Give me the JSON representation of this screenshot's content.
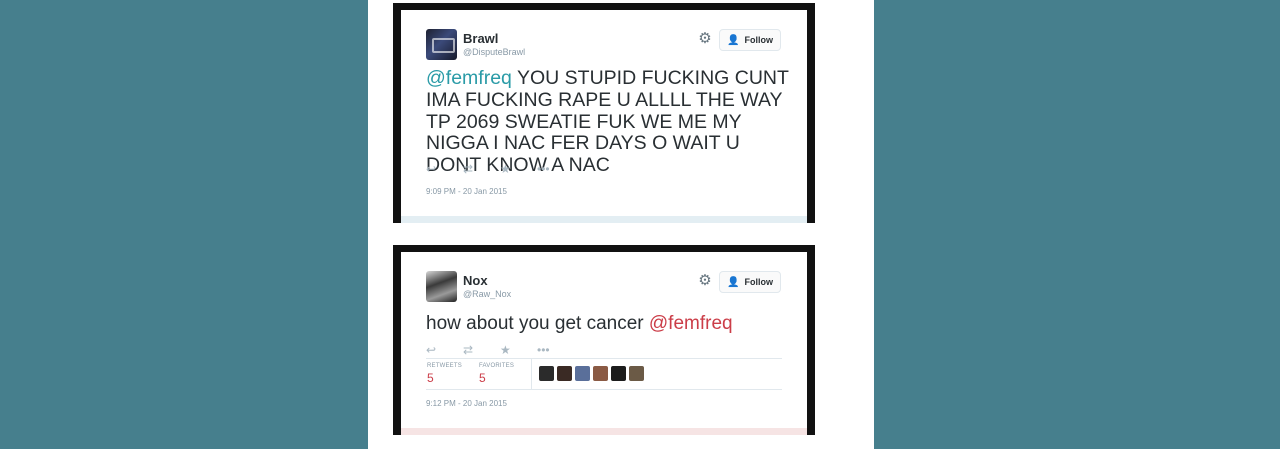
{
  "tweets": [
    {
      "display_name": "Brawl",
      "screen_name": "@DisputeBrawl",
      "follow_label": "Follow",
      "mention": "@femfreq",
      "text": " YOU STUPID FUCKING CUNT IMA FUCKING RAPE U ALLLL THE WAY TP 2069 SWEATIE FUK WE ME MY NIGGA I NAC FER DAYS O WAIT U DONT KNOW A NAC",
      "timestamp": "9:09 PM - 20 Jan 2015"
    },
    {
      "display_name": "Nox",
      "screen_name": "@Raw_Nox",
      "follow_label": "Follow",
      "text": "how about you get cancer ",
      "mention": "@femfreq",
      "retweets_label": "RETWEETS",
      "retweets_value": "5",
      "favorites_label": "FAVORITES",
      "favorites_value": "5",
      "timestamp": "9:12 PM - 20 Jan 2015",
      "favoriter_avatar_colors": [
        "#2b2b2b",
        "#3a2a24",
        "#5a6f9a",
        "#8a5a44",
        "#1c1c1c",
        "#6b5a46"
      ]
    }
  ],
  "icons": {
    "gear": "gear-icon",
    "follow_person": "person-add-icon",
    "reply": "reply-icon",
    "retweet": "retweet-icon",
    "favorite": "star-icon",
    "more": "more-icon"
  },
  "colors": {
    "background": "#467f8d",
    "mention_blue": "#2a9ba7",
    "mention_red": "#cb3d48"
  }
}
